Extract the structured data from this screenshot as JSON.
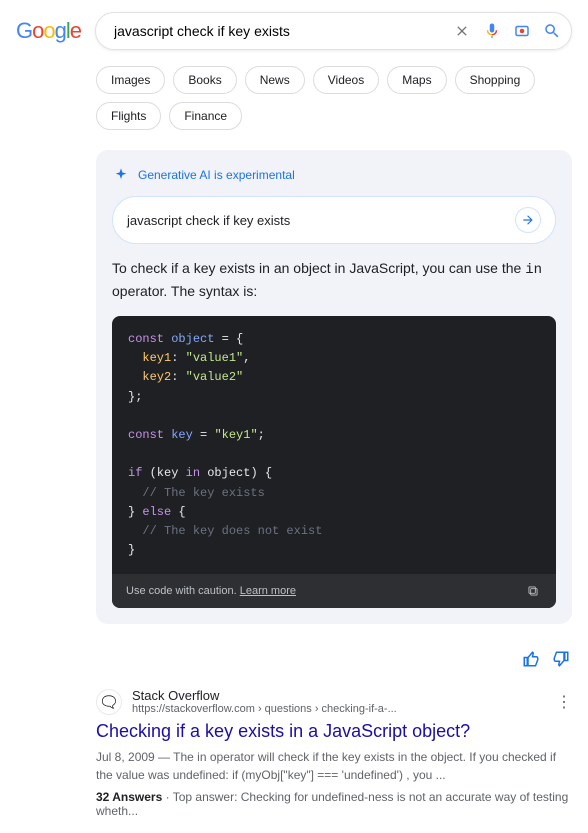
{
  "logo": "Google",
  "search": {
    "value": "javascript check if key exists"
  },
  "tabs": [
    "Images",
    "Books",
    "News",
    "Videos",
    "Maps",
    "Shopping",
    "Flights",
    "Finance"
  ],
  "ai": {
    "header": "Generative AI is experimental",
    "query": "javascript check if key exists",
    "body_pre": "To check if a key exists in an object in JavaScript, you can use the ",
    "body_code": "in",
    "body_post": " operator.  The syntax is:",
    "code_caution": "Use code with caution.",
    "learn_more": "Learn more",
    "code": {
      "l1_kw": "const",
      "l1_obj": " object",
      "l1_rest": " = {",
      "l2_prop": "key1",
      "l2_sep": ": ",
      "l2_str": "\"value1\"",
      "l2_end": ",",
      "l3_prop": "key2",
      "l3_sep": ": ",
      "l3_str": "\"value2\"",
      "l4": "};",
      "l5_kw": "const",
      "l5_obj": " key",
      "l5_rest": " = ",
      "l5_str": "\"key1\"",
      "l5_end": ";",
      "l6_kw1": "if",
      "l6_p1": " (key ",
      "l6_kw2": "in",
      "l6_p2": " object) {",
      "l7_cmt": "// The key exists",
      "l8_p1": "} ",
      "l8_kw": "else",
      "l8_p2": " {",
      "l9_cmt": "// The key does not exist",
      "l10": "}"
    }
  },
  "result": {
    "source": "Stack Overflow",
    "url": "https://stackoverflow.com",
    "crumb1": " › questions",
    "crumb2": " › checking-if-a-...",
    "title": "Checking if a key exists in a JavaScript object?",
    "date": "Jul 8, 2009",
    "snippet": " — The in operator will check if the key exists in the object. If you checked if the value was undefined: if (myObj[\"key\"] === 'undefined') , you ...",
    "answers_count": "32 Answers",
    "top_label": " · Top answer: ",
    "top_answer": "Checking for undefined-ness is not an accurate way of testing wheth..."
  }
}
